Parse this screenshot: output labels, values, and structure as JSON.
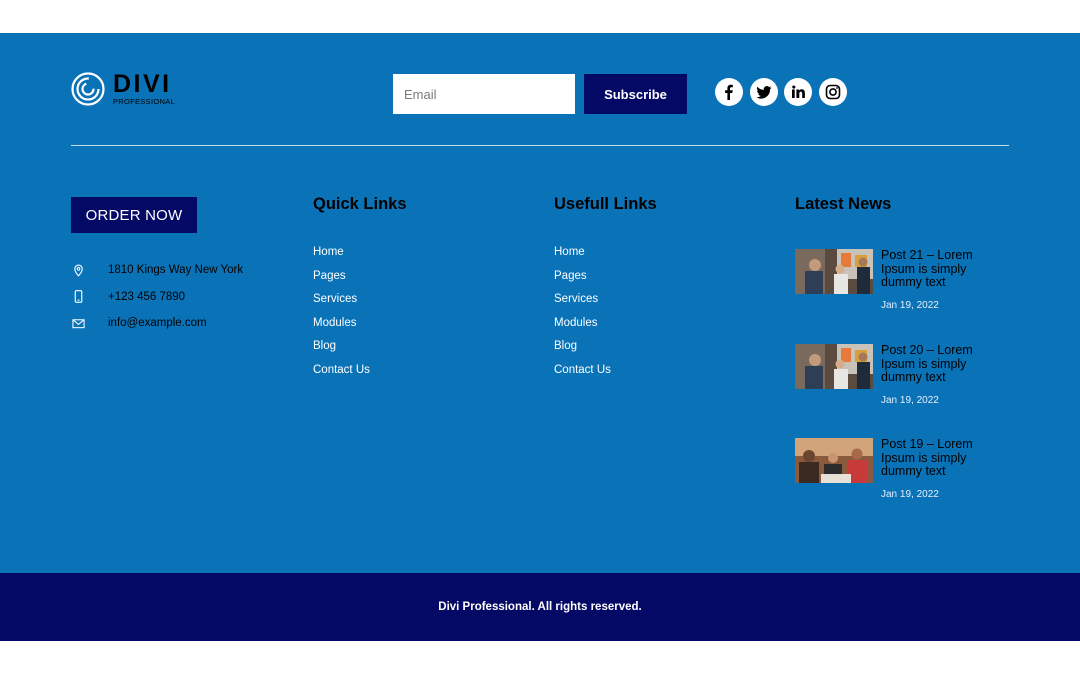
{
  "brand": {
    "name": "DIVI",
    "tagline": "PROFESSIONAL"
  },
  "subscribe": {
    "email_placeholder": "Email",
    "button_label": "Subscribe"
  },
  "social": [
    {
      "icon": "facebook-icon"
    },
    {
      "icon": "twitter-icon"
    },
    {
      "icon": "linkedin-icon"
    },
    {
      "icon": "instagram-icon"
    }
  ],
  "order_button": "ORDER NOW",
  "contact": {
    "address": "1810 Kings Way New York",
    "phone": "+123 456 7890",
    "email": "info@example.com"
  },
  "quick_links": {
    "title": "Quick Links",
    "items": [
      "Home",
      "Pages",
      "Services",
      "Modules",
      "Blog",
      "Contact Us"
    ]
  },
  "useful_links": {
    "title": "Usefull Links",
    "items": [
      "Home",
      "Pages",
      "Services",
      "Modules",
      "Blog",
      "Contact Us"
    ]
  },
  "latest_news": {
    "title": "Latest News",
    "posts": [
      {
        "title": "Post 21 – Lorem Ipsum is simply dummy text",
        "date": "Jan 19, 2022"
      },
      {
        "title": "Post 20 – Lorem Ipsum is simply dummy text",
        "date": "Jan 19, 2022"
      },
      {
        "title": "Post 19 – Lorem Ipsum is simply dummy text",
        "date": "Jan 19, 2022"
      }
    ]
  },
  "copyright": "Divi Professional. All rights reserved.",
  "colors": {
    "footer_bg": "#0a73b8",
    "accent_navy": "#050966",
    "text": "#ffffff"
  }
}
